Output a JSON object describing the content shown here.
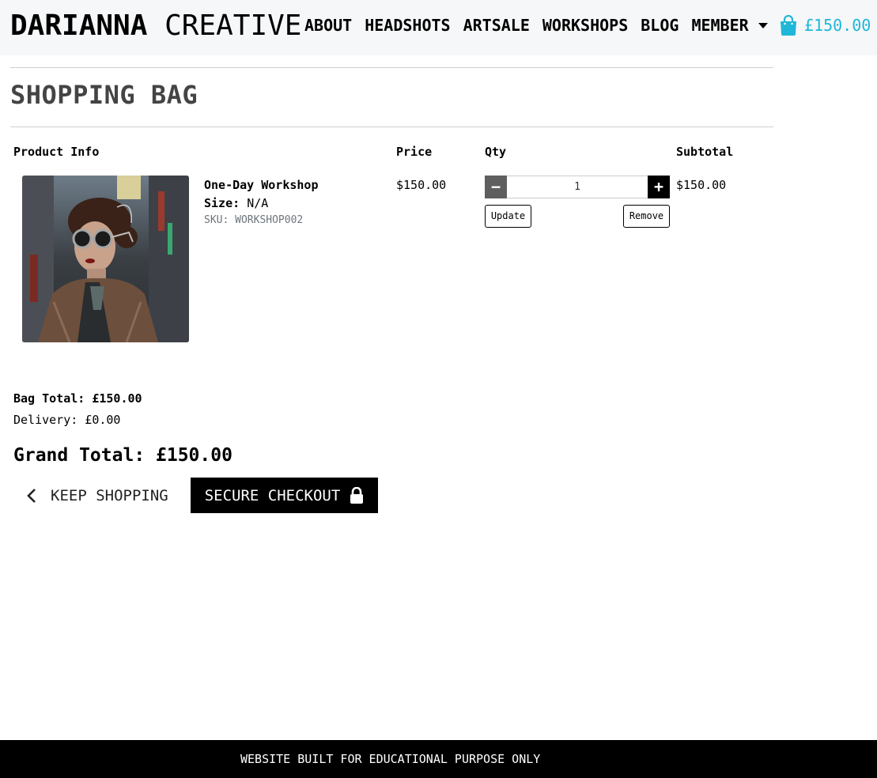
{
  "header": {
    "brand_bold": "DARIANNA",
    "brand_light": "CREATIVE",
    "nav": [
      "ABOUT",
      "HEADSHOTS",
      "ARTSALE",
      "WORKSHOPS",
      "BLOG",
      "MEMBER"
    ],
    "cart_total": "£150.00",
    "cart_icon": "shopping-bag-icon",
    "cart_color": "#1fb7d8"
  },
  "page": {
    "title": "SHOPPING BAG"
  },
  "table": {
    "headers": {
      "product": "Product Info",
      "price": "Price",
      "qty": "Qty",
      "subtotal": "Subtotal"
    },
    "items": [
      {
        "name": "One-Day Workshop",
        "size_label": "Size:",
        "size_value": "N/A",
        "sku": "SKU: WORKSHOP002",
        "price": "$150.00",
        "qty": "1",
        "subtotal": "$150.00",
        "update_label": "Update",
        "remove_label": "Remove",
        "minus_label": "−",
        "plus_label": "+"
      }
    ]
  },
  "totals": {
    "bag_total": "Bag Total: £150.00",
    "delivery": "Delivery: £0.00",
    "grand_total": "Grand Total: £150.00"
  },
  "actions": {
    "keep_shopping": "KEEP SHOPPING",
    "checkout": "SECURE CHECKOUT"
  },
  "footer": {
    "text": "WEBSITE BUILT FOR EDUCATIONAL PURPOSE ONLY"
  }
}
